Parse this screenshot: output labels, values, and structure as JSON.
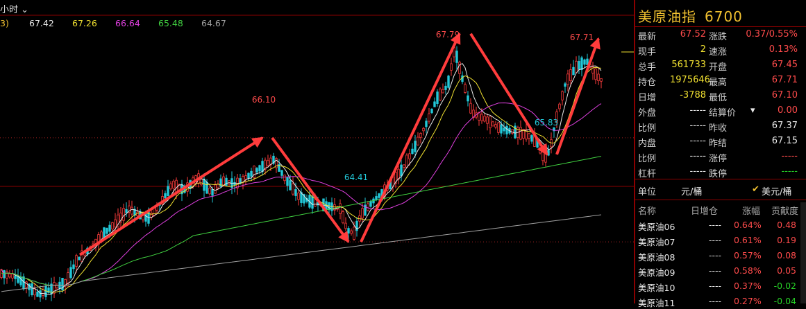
{
  "toolbar": {
    "period": "小时"
  },
  "ma_values": [
    {
      "text": "3)",
      "color": "#f0c030"
    },
    {
      "text": "67.42",
      "color": "#e8e8e8"
    },
    {
      "text": "67.26",
      "color": "#f0e030"
    },
    {
      "text": "66.64",
      "color": "#e040e0"
    },
    {
      "text": "65.48",
      "color": "#40d040"
    },
    {
      "text": "64.67",
      "color": "#a0a0a0"
    }
  ],
  "chart_data": {
    "type": "candlestick",
    "annotations": [
      {
        "label": "66.10",
        "color": "#ff4b4b"
      },
      {
        "label": "64.41",
        "color": "#22c8d8"
      },
      {
        "label": "67.79",
        "color": "#ff4b4b"
      },
      {
        "label": "65.83",
        "color": "#22c8d8"
      },
      {
        "label": "67.71",
        "color": "#ff4b4b"
      }
    ],
    "trend_arrows": [
      {
        "from": 64.2,
        "to": 66.1,
        "direction": "up"
      },
      {
        "from": 66.1,
        "to": 64.41,
        "direction": "down"
      },
      {
        "from": 64.41,
        "to": 67.79,
        "direction": "up"
      },
      {
        "from": 67.79,
        "to": 65.83,
        "direction": "down"
      },
      {
        "from": 65.83,
        "to": 67.71,
        "direction": "up"
      }
    ],
    "reference_lines": [
      66.1,
      64.41
    ],
    "ylim": [
      63.5,
      68.0
    ]
  },
  "panel": {
    "title": "美原油指",
    "code": "6700",
    "quote_left": [
      {
        "label": "最新",
        "value": "67.52",
        "color": "red"
      },
      {
        "label": "现手",
        "value": "2",
        "color": "yellow"
      },
      {
        "label": "总手",
        "value": "561733",
        "color": "yellow"
      },
      {
        "label": "持仓",
        "value": "1975646",
        "color": "yellow"
      },
      {
        "label": "日增",
        "value": "-3788",
        "color": "yellow"
      },
      {
        "label": "外盘",
        "value": "-----",
        "color": "white"
      },
      {
        "label": "比例",
        "value": "-----",
        "color": "white"
      },
      {
        "label": "内盘",
        "value": "-----",
        "color": "white"
      },
      {
        "label": "比例",
        "value": "-----",
        "color": "white"
      },
      {
        "label": "杠杆",
        "value": "-----",
        "color": "white"
      }
    ],
    "quote_right": [
      {
        "label": "涨跌",
        "value": "0.37/0.55%",
        "color": "red"
      },
      {
        "label": "速涨",
        "value": "0.13%",
        "color": "red"
      },
      {
        "label": "开盘",
        "value": "67.45",
        "color": "red"
      },
      {
        "label": "最高",
        "value": "67.71",
        "color": "red"
      },
      {
        "label": "最低",
        "value": "67.10",
        "color": "red"
      },
      {
        "label": "结算价",
        "value": "0.00",
        "color": "red"
      },
      {
        "label": "昨收",
        "value": "67.37",
        "color": "white"
      },
      {
        "label": "昨结",
        "value": "67.15",
        "color": "white"
      },
      {
        "label": "涨停",
        "value": "-----",
        "color": "red"
      },
      {
        "label": "跌停",
        "value": "-----",
        "color": "green"
      }
    ],
    "unit": {
      "label": "单位",
      "option1": "元/桶",
      "option2": "美元/桶",
      "check": "✔"
    },
    "list_headers": [
      "名称",
      "日增仓",
      "涨幅",
      "贡献度"
    ],
    "list_rows": [
      {
        "name": "美原油06",
        "oi": "----",
        "chg": "0.64%",
        "contrib": "0.48",
        "contrib_color": "red"
      },
      {
        "name": "美原油07",
        "oi": "----",
        "chg": "0.61%",
        "contrib": "0.19",
        "contrib_color": "red"
      },
      {
        "name": "美原油08",
        "oi": "----",
        "chg": "0.57%",
        "contrib": "0.08",
        "contrib_color": "red"
      },
      {
        "name": "美原油09",
        "oi": "----",
        "chg": "0.58%",
        "contrib": "0.05",
        "contrib_color": "red"
      },
      {
        "name": "美原油10",
        "oi": "----",
        "chg": "0.37%",
        "contrib": "-0.02",
        "contrib_color": "green"
      },
      {
        "name": "美原油11",
        "oi": "----",
        "chg": "0.27%",
        "contrib": "-0.04",
        "contrib_color": "green"
      }
    ]
  }
}
